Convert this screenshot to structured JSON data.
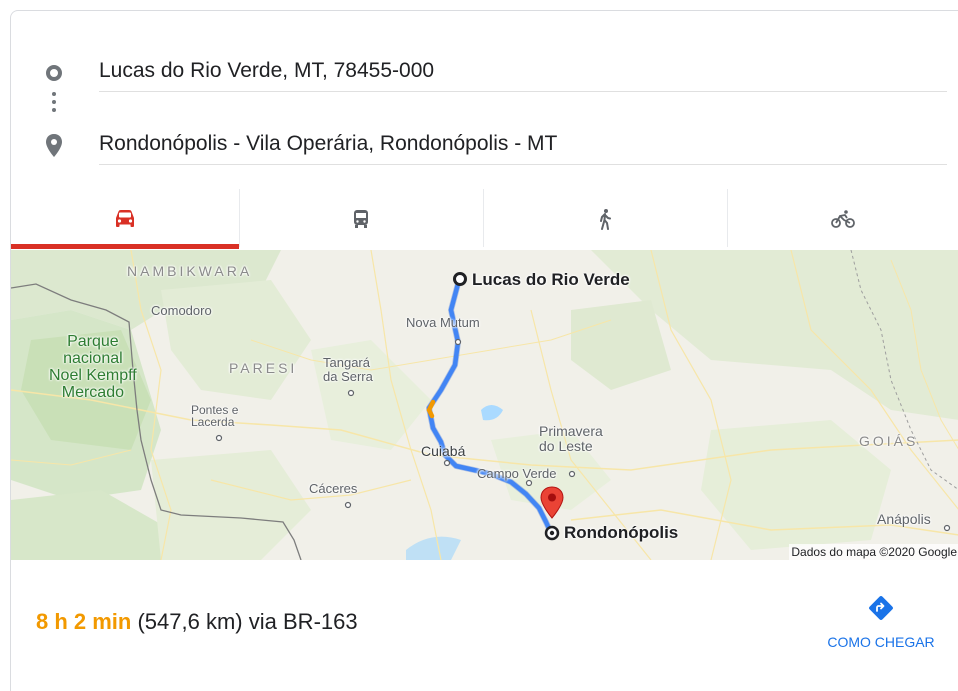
{
  "route": {
    "origin": "Lucas do Rio Verde, MT, 78455-000",
    "destination": "Rondonópolis - Vila Operária, Rondonópolis - MT"
  },
  "tabs": [
    {
      "icon": "car-icon",
      "active": true
    },
    {
      "icon": "transit-icon",
      "active": false
    },
    {
      "icon": "walking-icon",
      "active": false
    },
    {
      "icon": "bicycle-icon",
      "active": false
    }
  ],
  "map": {
    "regions": {
      "nambikwara": "NAMBIKWARA",
      "paresi": "PARESI",
      "goias": "GOIÁS"
    },
    "park": {
      "line1": "Parque",
      "line2": "nacional",
      "line3": "Noel Kempff",
      "line4": "Mercado"
    },
    "places": {
      "comodoro": "Comodoro",
      "nova_mutum": "Nova Mutum",
      "tangara_1": "Tangará",
      "tangara_2": "da Serra",
      "pontes_1": "Pontes e",
      "pontes_2": "Lacerda",
      "cuiaba": "Cuiabá",
      "campo_verde": "Campo Verde",
      "primavera_1": "Primavera",
      "primavera_2": "do Leste",
      "caceres": "Cáceres",
      "anapolis": "Anápolis"
    },
    "origin_label": "Lucas do Rio Verde",
    "destination_label": "Rondonópolis",
    "attribution": "Dados do mapa ©2020 Google",
    "route_color": "#4285f4",
    "marker_color": "#ea4335"
  },
  "summary": {
    "duration": "8 h 2 min",
    "distance": "(547,6 km)",
    "via": "via BR-163"
  },
  "directions_button": {
    "label": "COMO CHEGAR",
    "icon": "directions-icon"
  }
}
